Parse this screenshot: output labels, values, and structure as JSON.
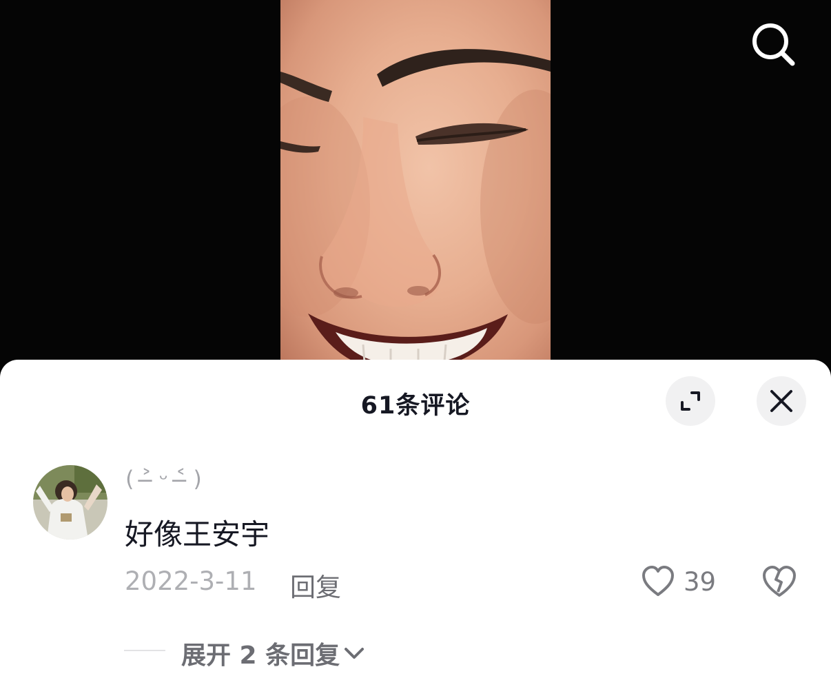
{
  "video": {
    "content": "close-up smiling face"
  },
  "header": {
    "search_icon": "search-icon"
  },
  "comments_panel": {
    "title": "61条评论",
    "expand_icon": "fullscreen-icon",
    "close_icon": "close-icon",
    "comment": {
      "username": "( ˃̶ ᵕ ˂̶ )",
      "text": "好像王安宇",
      "date": "2022-3-11",
      "reply_label": "回复",
      "like_count": "39",
      "like_icon": "heart-outline-icon",
      "dislike_icon": "broken-heart-icon"
    },
    "expand_replies": {
      "label": "展开 2 条回复",
      "icon": "chevron-down-icon"
    }
  },
  "colors": {
    "background": "#050505",
    "sheet": "#ffffff",
    "title_text": "#161823",
    "muted_text": "#aeafb3",
    "secondary_text": "#6c6d73"
  }
}
